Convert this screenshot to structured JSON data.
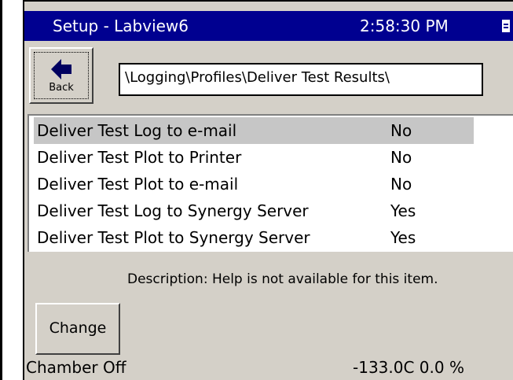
{
  "titlebar": {
    "title": "Setup - Labview6",
    "clock": "2:58:30 PM"
  },
  "toolbar": {
    "back_label": "Back",
    "path": "\\Logging\\Profiles\\Deliver Test Results\\"
  },
  "list": {
    "items": [
      {
        "label": "Deliver Test Log to e-mail",
        "value": "No",
        "selected": true
      },
      {
        "label": "Deliver Test Plot to Printer",
        "value": "No",
        "selected": false
      },
      {
        "label": "Deliver Test Plot to e-mail",
        "value": "No",
        "selected": false
      },
      {
        "label": "Deliver Test Log to Synergy Server",
        "value": "Yes",
        "selected": false
      },
      {
        "label": "Deliver Test Plot to Synergy Server",
        "value": "Yes",
        "selected": false
      }
    ]
  },
  "description": "Description:  Help is not available for this item.",
  "change_label": "Change",
  "status": {
    "chamber": "Chamber Off",
    "reading": "-133.0C  0.0 %"
  },
  "colors": {
    "titlebar": "#000090",
    "window": "#d4d0c8",
    "selection": "#c6c6c6"
  },
  "icons": {
    "back": "left-arrow-icon",
    "title": "document-icon"
  }
}
